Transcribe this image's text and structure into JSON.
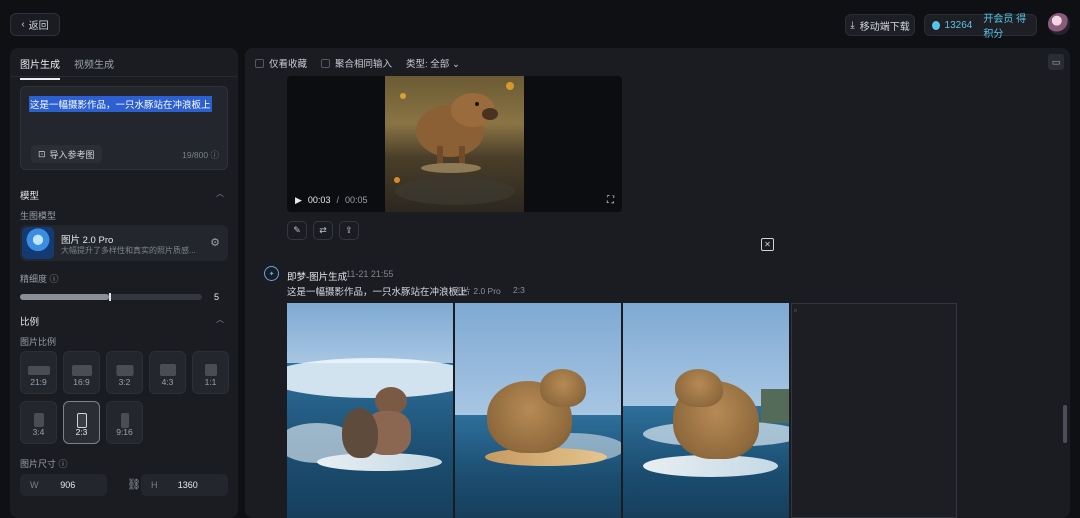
{
  "topbar": {
    "back_label": "返回",
    "mobile_download_label": "移动端下载",
    "points": "13264",
    "vip_label": "开会员 得积分"
  },
  "left": {
    "tabs": [
      {
        "label": "图片生成",
        "active": true
      },
      {
        "label": "视频生成",
        "active": false
      }
    ],
    "prompt": {
      "value": "这是一幅摄影作品，一只水豚站在冲浪板上",
      "ref_button_label": "导入参考图",
      "char_count": "19/800"
    },
    "model": {
      "section_title": "模型",
      "sub_label": "生图模型",
      "name": "图片 2.0 Pro",
      "description": "大幅提升了多样性和真实的照片质感..."
    },
    "precision": {
      "label": "精细度",
      "value": 5,
      "fraction": 0.49
    },
    "ratio": {
      "section_title": "比例",
      "sub_label": "图片比例",
      "options": [
        {
          "label": "21:9",
          "active": false
        },
        {
          "label": "16:9",
          "active": false
        },
        {
          "label": "3:2",
          "active": false
        },
        {
          "label": "4:3",
          "active": false
        },
        {
          "label": "1:1",
          "active": false
        },
        {
          "label": "3:4",
          "active": false
        },
        {
          "label": "2:3",
          "active": true
        },
        {
          "label": "9:16",
          "active": false
        }
      ]
    },
    "size": {
      "label": "图片尺寸",
      "width_key": "W",
      "width": "906",
      "height_key": "H",
      "height": "1360"
    }
  },
  "right": {
    "filters": {
      "favorites_only": "仅看收藏",
      "aggregate_input": "聚合相同输入",
      "type_label": "类型: 全部"
    },
    "video": {
      "current_time": "00:03",
      "separator": "/",
      "duration": "00:05"
    },
    "generation": {
      "title": "即梦-图片生成",
      "time": "11-21  21:55",
      "prompt": "这是一幅摄影作品，一只水豚站在冲浪板上",
      "model": "图片 2.0 Pro",
      "ratio": "2:3"
    }
  },
  "colors": {
    "accent_blue": "#5ec4e6",
    "selection": "#2c5fd0",
    "panel": "#1a1c22",
    "background": "#0f1014"
  }
}
